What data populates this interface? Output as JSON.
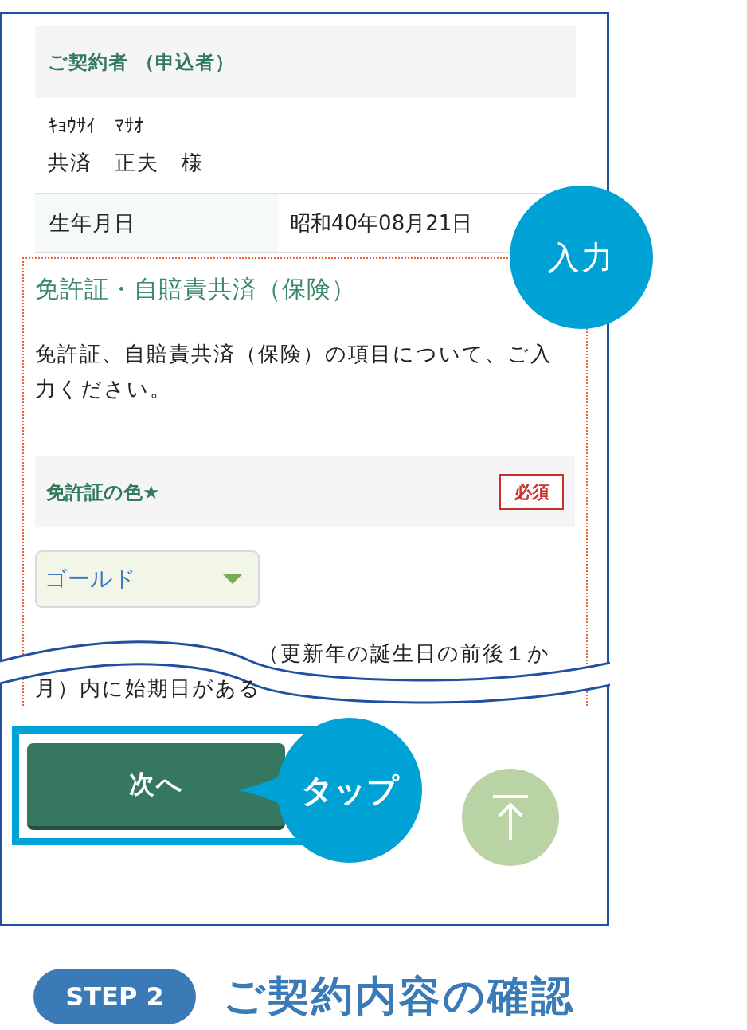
{
  "contract_holder": {
    "heading": "ご契約者 （申込者）",
    "name_kana": "ｷｮｳｻｲ　ﾏｻｵ",
    "name": "共済　正夫　様"
  },
  "birth_date": {
    "label": "生年月日",
    "value": "昭和40年08月21日"
  },
  "license_section": {
    "title": "免許証・自賠責共済（保険）",
    "description": "免許証、自賠責共済（保険）の項目について、ご入力ください。",
    "license_color": {
      "label": "免許証の色★",
      "required_badge": "必須",
      "value": "ゴールド"
    },
    "note_visible_lines": [
      "（更新年の誕生日の前後１か",
      "月）内に始期日がある"
    ]
  },
  "next_button": {
    "label": "次へ"
  },
  "callouts": [
    {
      "kind": "input",
      "text": "入力"
    },
    {
      "kind": "tap",
      "text": "タップ"
    }
  ],
  "step": {
    "badge": "STEP 2",
    "title": "ご契約内容の確認"
  }
}
